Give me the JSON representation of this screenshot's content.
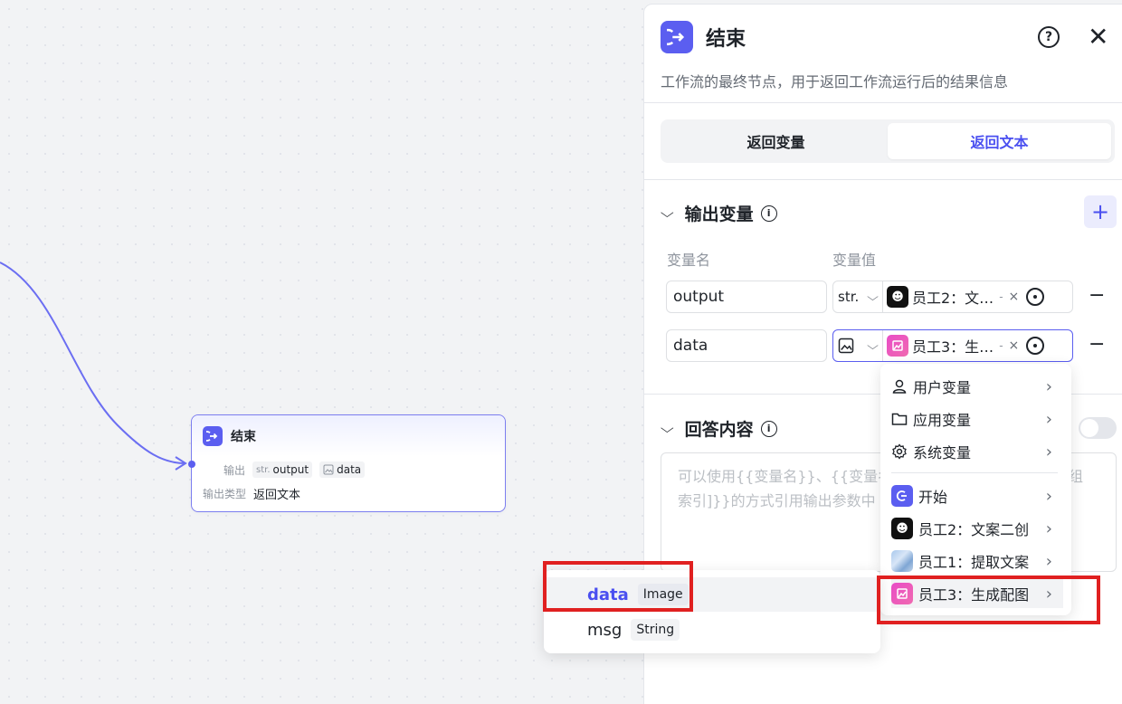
{
  "canvas": {
    "node": {
      "title": "结束",
      "output_label": "输出",
      "output_chips": [
        {
          "type_glyph": "str.",
          "name": "output"
        },
        {
          "type_glyph": "image",
          "name": "data"
        }
      ],
      "type_label": "输出类型",
      "type_value": "返回文本"
    }
  },
  "panel": {
    "title": "结束",
    "help": "?",
    "close": "✕",
    "description": "工作流的最终节点，用于返回工作流运行后的结果信息",
    "tabs": [
      {
        "label": "返回变量",
        "active": false
      },
      {
        "label": "返回文本",
        "active": true
      }
    ],
    "output_section": {
      "title": "输出变量",
      "add": "+",
      "col_name": "变量名",
      "col_value": "变量值",
      "rows": [
        {
          "name": "output",
          "type": "str.",
          "ref_label": "员工2：文…",
          "ref_more": "-",
          "ref_x": "×"
        },
        {
          "name": "data",
          "type": "image",
          "ref_label": "员工3：生…",
          "ref_more": "-",
          "ref_x": "×"
        }
      ],
      "minus": "−"
    },
    "answer_section": {
      "title": "回答内容",
      "placeholder_line1": "可以使用{{变量名}}、{{变量名",
      "placeholder_line1_tail": "组",
      "placeholder_line2": "索引]}}的方式引用输出参数中"
    }
  },
  "menu": {
    "items": [
      {
        "label": "用户变量",
        "icon": "user-icon"
      },
      {
        "label": "应用变量",
        "icon": "folder-icon"
      },
      {
        "label": "系统变量",
        "icon": "gear-icon"
      },
      {
        "label": "开始",
        "icon": "start-node-icon"
      },
      {
        "label": "员工2：文案二创",
        "icon": "agent-black-icon"
      },
      {
        "label": "员工1：提取文案",
        "icon": "agent-photo-icon"
      },
      {
        "label": "员工3：生成配图",
        "icon": "agent-pink-icon"
      }
    ]
  },
  "submenu": {
    "items": [
      {
        "name": "data",
        "type": "Image",
        "selected": true
      },
      {
        "name": "msg",
        "type": "String",
        "selected": false
      }
    ]
  },
  "colors": {
    "accent": "#5b5ef0",
    "highlight_box": "#e02020"
  }
}
